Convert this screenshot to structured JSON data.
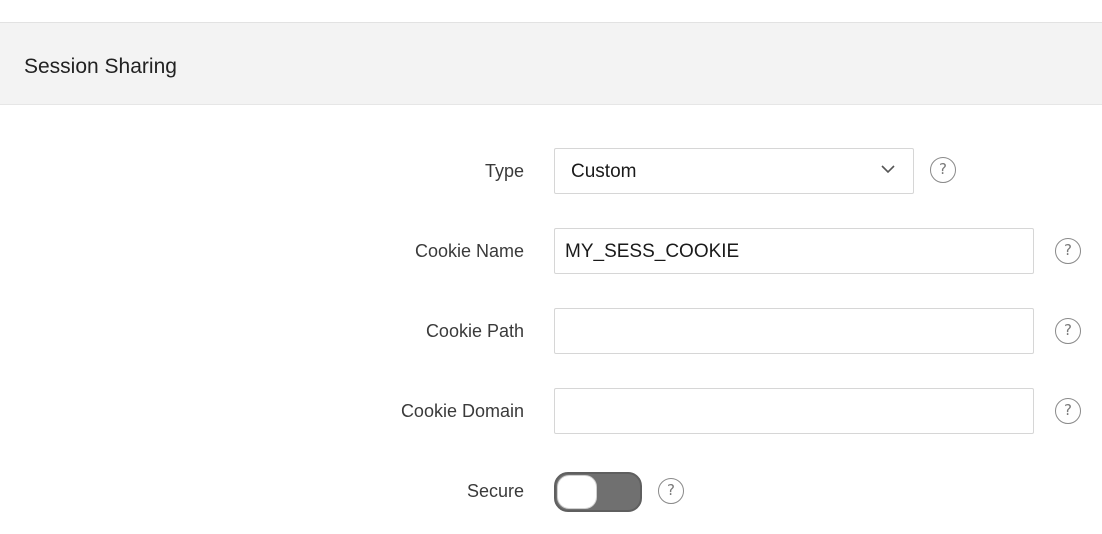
{
  "region": {
    "title": "Session Sharing"
  },
  "form": {
    "type": {
      "label": "Type",
      "value": "Custom",
      "help_icon": "help-icon"
    },
    "cookie_name": {
      "label": "Cookie Name",
      "value": "MY_SESS_COOKIE",
      "help_icon": "help-icon"
    },
    "cookie_path": {
      "label": "Cookie Path",
      "value": "",
      "help_icon": "help-icon"
    },
    "cookie_domain": {
      "label": "Cookie Domain",
      "value": "",
      "help_icon": "help-icon"
    },
    "secure": {
      "label": "Secure",
      "value": "off",
      "help_icon": "help-icon"
    }
  },
  "help_glyph": "?"
}
